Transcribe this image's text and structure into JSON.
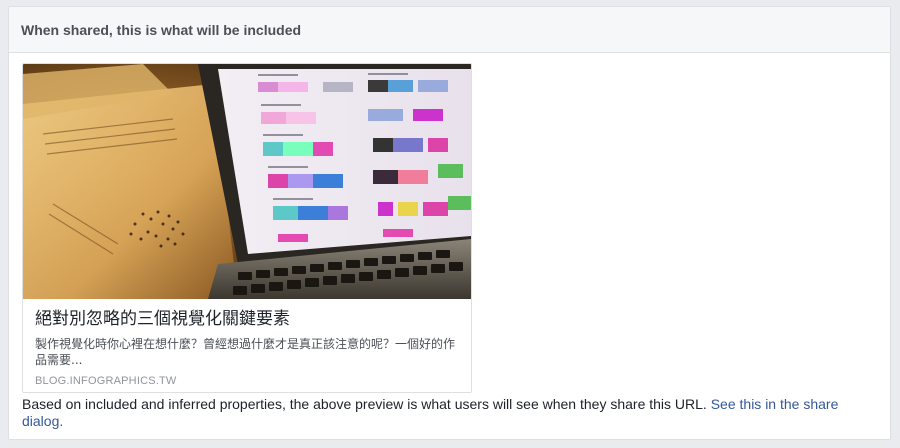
{
  "panel": {
    "header_title": "When shared, this is what will be included"
  },
  "preview_card": {
    "image_icon": "laptop-infographic-photo",
    "title": "絕對別忽略的三個視覺化關鍵要素",
    "description": "製作視覺化時你心裡在想什麼？曾經想過什麼才是真正該注意的呢？一個好的作品需要...",
    "domain": "BLOG.INFOGRAPHICS.TW"
  },
  "footer": {
    "note": "Based on included and inferred properties, the above preview is what users will see when they share this URL. ",
    "link_text": "See this in the share dialog."
  },
  "colors": {
    "link": "#365899",
    "header_bg": "#f6f7f9",
    "border": "#dddfe2"
  }
}
